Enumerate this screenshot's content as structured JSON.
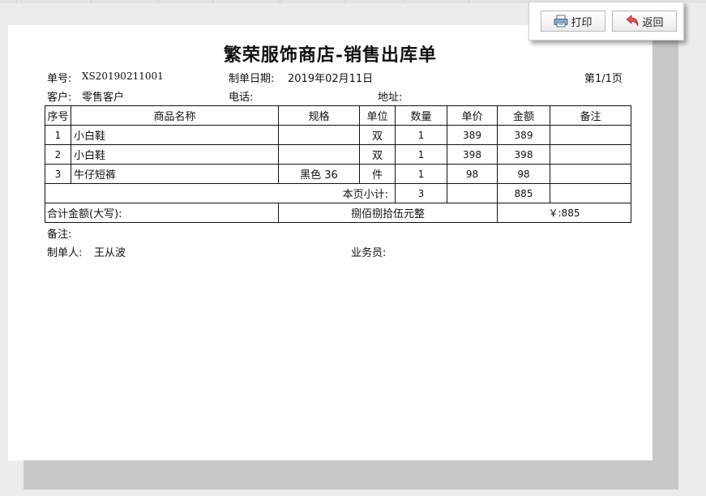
{
  "toolbar": {
    "print_label": "打印",
    "back_label": "返回"
  },
  "document": {
    "title": "繁荣服饰商店-销售出库单",
    "order_no_label": "单号:",
    "order_no": "XS20190211001",
    "date_label": "制单日期:",
    "date": "2019年02月11日",
    "page_info": "第1/1页",
    "customer_label": "客户:",
    "customer": "零售客户",
    "phone_label": "电话:",
    "phone": "",
    "address_label": "地址:",
    "address": ""
  },
  "table": {
    "headers": [
      "序号",
      "商品名称",
      "规格",
      "单位",
      "数量",
      "单价",
      "金额",
      "备注"
    ],
    "rows": [
      {
        "no": "1",
        "name": "小白鞋",
        "spec": "",
        "unit": "双",
        "qty": "1",
        "price": "389",
        "amount": "389",
        "remark": ""
      },
      {
        "no": "2",
        "name": "小白鞋",
        "spec": "",
        "unit": "双",
        "qty": "1",
        "price": "398",
        "amount": "398",
        "remark": ""
      },
      {
        "no": "3",
        "name": "牛仔短裤",
        "spec": "黑色 36",
        "unit": "件",
        "qty": "1",
        "price": "98",
        "amount": "98",
        "remark": ""
      }
    ],
    "subtotal_label": "本页小计:",
    "subtotal_qty": "3",
    "subtotal_amount": "885",
    "total_label": "合计金额(大写):",
    "total_words": "捌佰捌拾伍元整",
    "total_amount": "￥:885"
  },
  "footer": {
    "remark_label": "备注:",
    "maker_label": "制单人:",
    "maker": "王从波",
    "salesman_label": "业务员:",
    "salesman": ""
  },
  "icons": {
    "print": "printer-icon",
    "back": "return-arrow-icon"
  }
}
